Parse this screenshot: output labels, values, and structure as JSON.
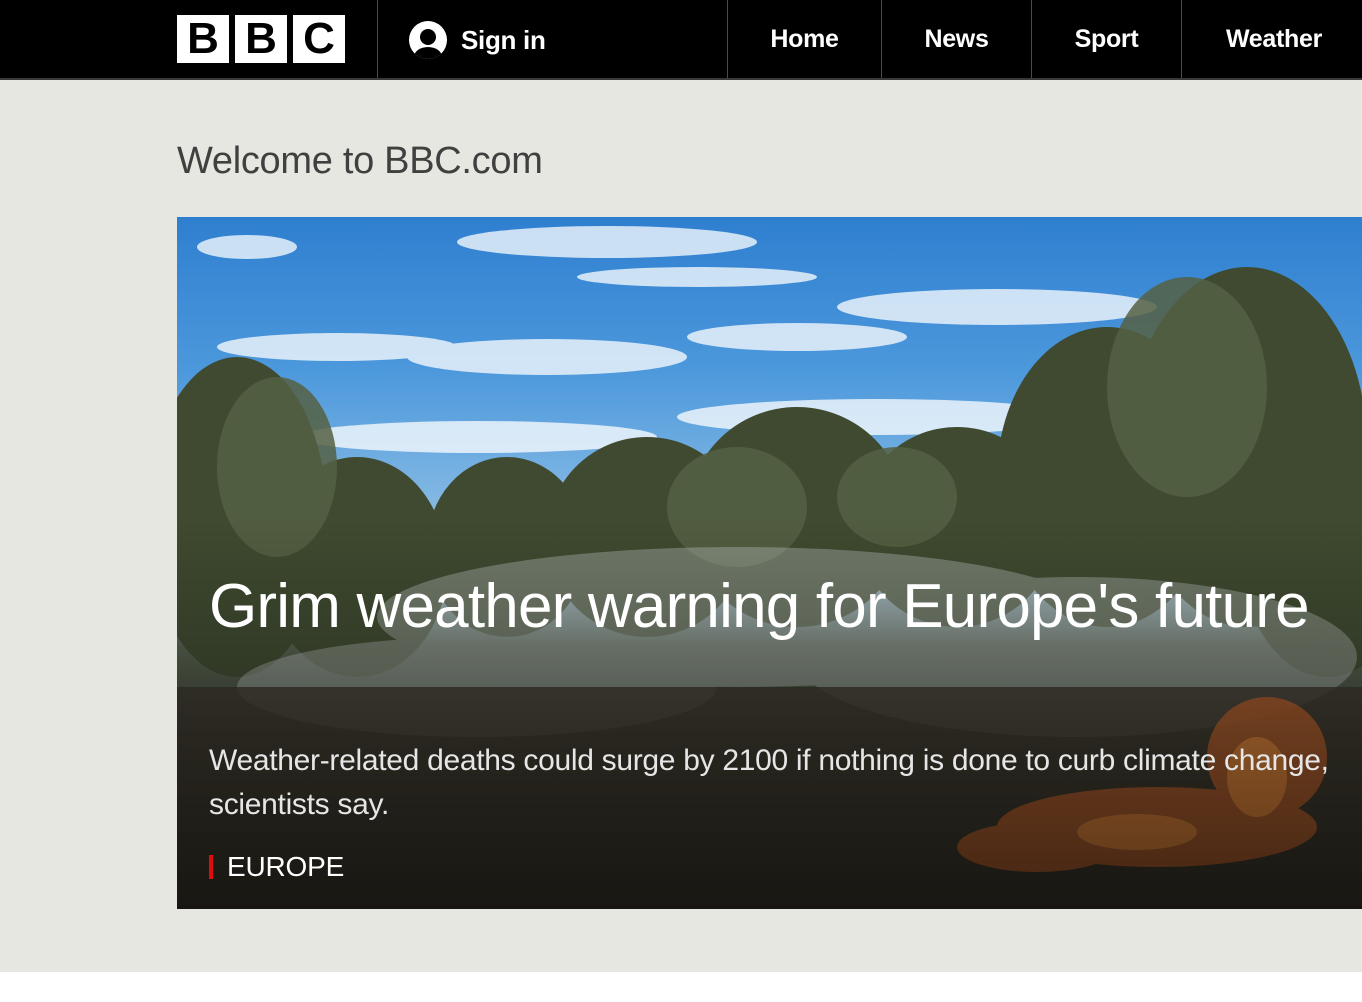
{
  "header": {
    "logo_letters": [
      "B",
      "B",
      "C"
    ],
    "sign_in_label": "Sign in",
    "nav": [
      {
        "label": "Home"
      },
      {
        "label": "News"
      },
      {
        "label": "Sport"
      },
      {
        "label": "Weather"
      }
    ],
    "background_color": "#000000",
    "icons": {
      "user": "user-avatar-icon"
    }
  },
  "main": {
    "welcome": "Welcome to BBC.com",
    "background_color": "#e7e7e1",
    "hero": {
      "headline": "Grim weather warning for Europe's future",
      "summary": "Weather-related deaths could surge by 2100 if nothing is done to curb climate change, scientists say.",
      "section_tag": "EUROPE",
      "tag_color": "#e20b0b",
      "image": "smoky scrubland with burning undergrowth under a blue sky"
    }
  }
}
